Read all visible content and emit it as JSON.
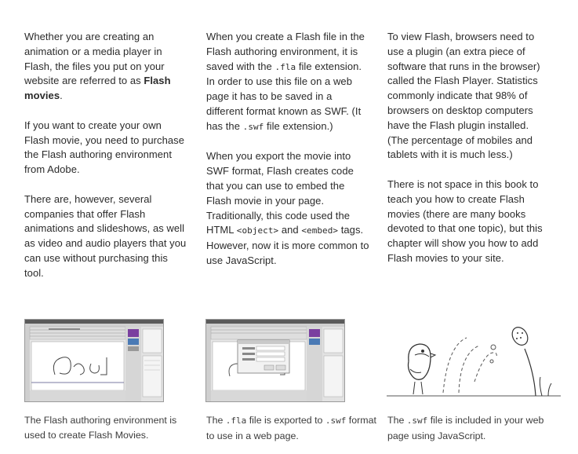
{
  "columns": [
    {
      "p1": {
        "a": "Whether you are creating an animation or a media player in Flash, the files you put on your website are referred to as ",
        "bold": "Flash movies",
        "end": "."
      },
      "p2": "If you want to create your own Flash movie, you need to purchase the Flash authoring environment from Adobe.",
      "p3": "There are, however, several companies that offer Flash animations and slideshows, as well as video and audio players that you can use without purchasing this tool."
    },
    {
      "p1": {
        "a": "When you create a Flash file in the Flash authoring environment, it is saved with the ",
        "code1": ".fla",
        "b": " file extension. In order to use this file on a web page it has to be saved in a different format known as SWF. (It has the ",
        "code2": ".swf",
        "c": " file extension.)"
      },
      "p2": {
        "a": "When you export the movie into SWF format, Flash creates code that you can use to embed the Flash movie in your page. Traditionally, this code used the HTML ",
        "code1": "<object>",
        "b": " and ",
        "code2": "<embed>",
        "c": " tags. However, now it is more common to use JavaScript."
      }
    },
    {
      "p1": "To view Flash, browsers need to use a plugin (an extra piece of software that runs in the browser) called the Flash Player. Statistics commonly indicate that 98% of browsers on desktop computers have the Flash plugin installed. (The percentage of mobiles and tablets with it is much less.)",
      "p2": "There is not space in this book to teach you how to create Flash movies (there are many books devoted to that one topic), but this chapter will show you how to add Flash movies to your site."
    }
  ],
  "captions": [
    {
      "text": "The Flash authoring environment is used to create Flash Movies."
    },
    {
      "a": "The ",
      "code1": ".fla",
      "b": " file is exported to ",
      "code2": ".swf",
      "c": " format to use in a web page."
    },
    {
      "a": "The ",
      "code1": ".swf",
      "b": " file is included in your web page using JavaScript."
    }
  ]
}
